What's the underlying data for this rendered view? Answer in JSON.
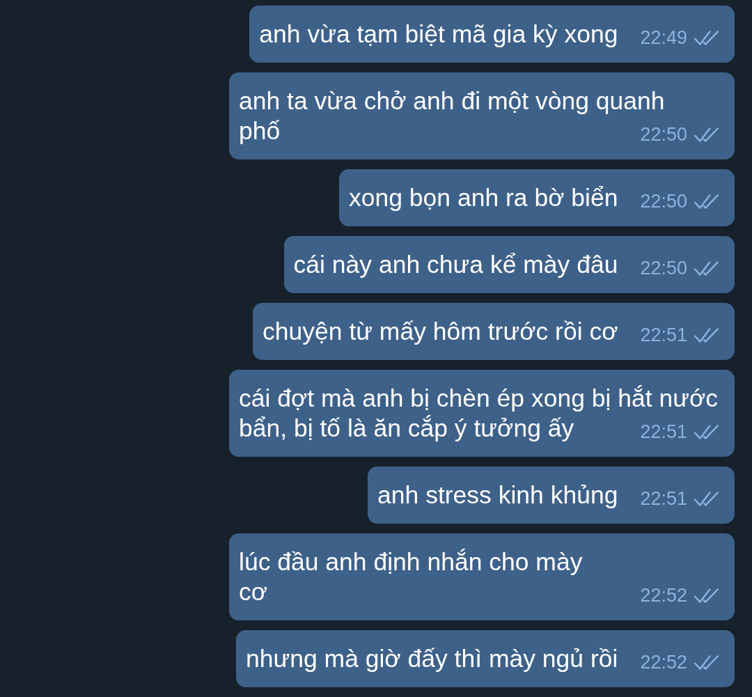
{
  "messages": [
    {
      "text": "anh vừa tạm biệt mã gia kỳ xong",
      "time": "22:49",
      "read": true
    },
    {
      "text": "anh ta vừa chở anh đi một vòng quanh\nphố",
      "time": "22:50",
      "read": true
    },
    {
      "text": "xong bọn anh ra bờ biển",
      "time": "22:50",
      "read": true
    },
    {
      "text": "cái này anh chưa kể mày đâu",
      "time": "22:50",
      "read": true
    },
    {
      "text": "chuyện từ mấy hôm trước rồi cơ",
      "time": "22:51",
      "read": true
    },
    {
      "text": "cái đợt mà anh bị chèn ép xong bị hắt nước\nbẩn, bị tố là ăn cắp ý tưởng ấy",
      "time": "22:51",
      "read": true
    },
    {
      "text": "anh stress kinh khủng",
      "time": "22:51",
      "read": true
    },
    {
      "text": "lúc đầu anh định nhắn cho mày\ncơ",
      "time": "22:52",
      "read": true
    },
    {
      "text": "nhưng mà giờ đấy thì mày ngủ rồi",
      "time": "22:52",
      "read": true
    }
  ]
}
